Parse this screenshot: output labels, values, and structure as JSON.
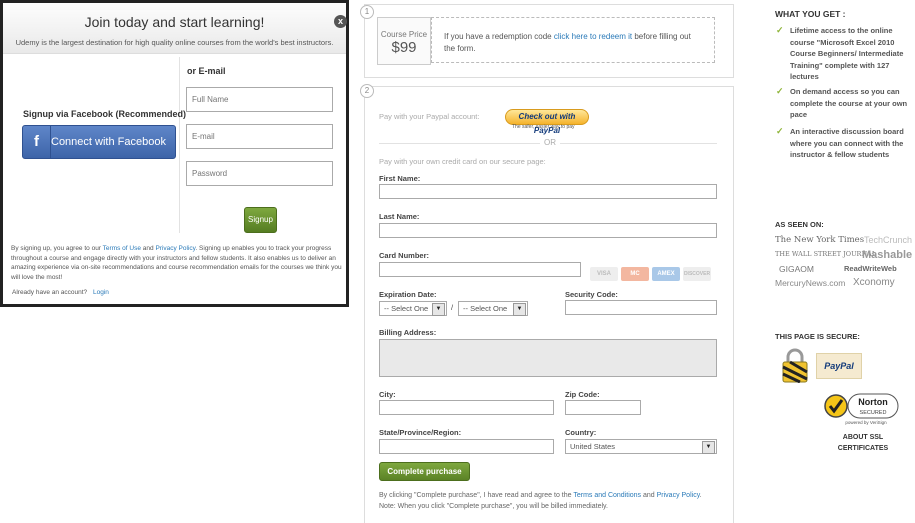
{
  "colors": {
    "accent_green": "#6a9a2f",
    "link_blue": "#2a7ab8",
    "facebook_blue": "#4b72b8"
  },
  "modal": {
    "title": "Join today and start learning!",
    "subtitle": "Udemy is the largest destination for high quality online courses from the world's best instructors.",
    "close_glyph": "x",
    "facebook_label": "Signup via Facebook (Recommended)",
    "facebook_icon": "f",
    "facebook_button": "Connect with Facebook",
    "or_email": "or E-mail",
    "fullname_placeholder": "Full Name",
    "email_placeholder": "E-mail",
    "password_placeholder": "Password",
    "signup_button": "Signup",
    "terms_prefix": "By signing up, you agree to our ",
    "terms_link": "Terms of Use",
    "terms_and": " and ",
    "privacy_link": "Privacy Policy",
    "terms_suffix": ". Signing up enables you to track your progress throughout a course and engage directly with your instructors and fellow students. It also enables us to deliver an amazing experience via on-site recommendations and course recommendation emails for the courses we think you will love the most!",
    "have_account": "Already have an account?",
    "login_link": "Login"
  },
  "checkout": {
    "step1_number": "1",
    "step2_number": "2",
    "price_label": "Course Price",
    "price_value": "$99",
    "redeem_prefix": "If you have a redemption code ",
    "redeem_link": "click here to redeem it",
    "redeem_suffix": " before filling out the form.",
    "paypal_prompt": "Pay with your Paypal account:",
    "paypal_button": "Check out with PayPal",
    "paypal_tagline": "The safer, easier way to pay",
    "or": "OR",
    "card_prompt": "Pay with your own credit card on our secure page:",
    "first_name": "First Name:",
    "last_name": "Last Name:",
    "card_number": "Card Number:",
    "card_brands": [
      "VISA",
      "MC",
      "AMEX",
      "DISCOVER"
    ],
    "expiration": "Expiration Date:",
    "exp_month": "-- Select One",
    "exp_sep": "/",
    "exp_year": "-- Select One",
    "security_code": "Security Code:",
    "billing_address": "Billing Address:",
    "city": "City:",
    "zip": "Zip Code:",
    "state": "State/Province/Region:",
    "country": "Country:",
    "country_value": "United States",
    "complete_button": "Complete purchase",
    "agree_prefix": "By clicking \"Complete purchase\", I have read and agree to the ",
    "agree_terms": "Terms and Conditions",
    "agree_and": " and ",
    "agree_privacy": "Privacy Policy",
    "agree_end": ".",
    "billing_note": "Note: When you click \"Complete purchase\", you will be billed immediately."
  },
  "sidebar": {
    "what_you_get": "WHAT YOU GET :",
    "benefits": [
      "Lifetime access to the online course \"Microsoft Excel 2010 Course Beginners/ Intermediate Training\" complete with 127 lectures",
      "On demand access so you can complete the course at your own pace",
      "An interactive discussion board where you can connect with the instructor & fellow students"
    ],
    "as_seen_on": "AS SEEN ON:",
    "press": [
      "The New York Times",
      "TechCrunch",
      "THE WALL STREET JOURNAL",
      "Mashable",
      "GIGAOM",
      "ReadWriteWeb",
      "MercuryNews.com",
      "Xconomy"
    ],
    "secure_heading": "THIS PAGE IS SECURE:",
    "paypal_badge": "PayPal",
    "norton_label": "Norton",
    "norton_secured": "SECURED",
    "norton_powered": "powered by VeriSign",
    "ssl_about": "ABOUT SSL CERTIFICATES"
  }
}
